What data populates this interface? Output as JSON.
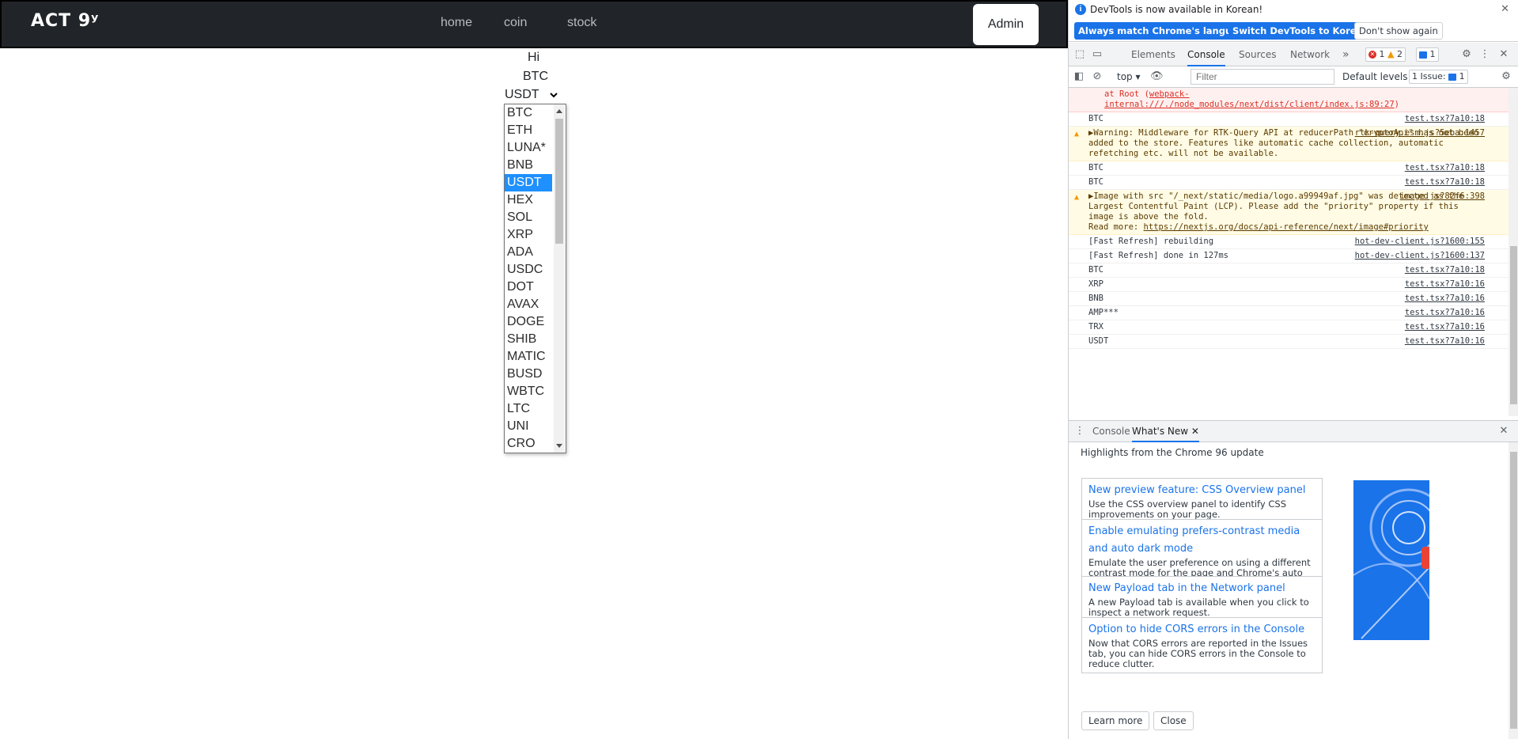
{
  "nav": {
    "logo": "ACT 9ʸ",
    "links": [
      "home",
      "coin",
      "stock"
    ],
    "admin": "Admin"
  },
  "main": {
    "greeting": "Hi",
    "selected_text": "BTC",
    "select_value": "USDT",
    "options": [
      "BTC",
      "ETH",
      "LUNA*",
      "BNB",
      "USDT",
      "HEX",
      "SOL",
      "XRP",
      "ADA",
      "USDC",
      "DOT",
      "AVAX",
      "DOGE",
      "SHIB",
      "MATIC",
      "BUSD",
      "WBTC",
      "LTC",
      "UNI",
      "CRO"
    ],
    "selected_option": "USDT"
  },
  "devtools": {
    "infobar": {
      "message": "DevTools is now available in Korean!",
      "btn_match": "Always match Chrome's language",
      "btn_switch": "Switch DevTools to Korean",
      "btn_dismiss": "Don't show again"
    },
    "tabs": [
      "Elements",
      "Console",
      "Sources",
      "Network"
    ],
    "active_tab": "Console",
    "more_tabs": "»",
    "badges": {
      "errors": "1",
      "warnings": "2",
      "messages": "1"
    },
    "filter": {
      "context": "top",
      "placeholder": "Filter",
      "levels": "Default levels",
      "issues": "1 Issue:",
      "issues_count": "1"
    },
    "console": [
      {
        "type": "error",
        "text": "at Root (",
        "link": "webpack-internal:///./node_modules/next/dist/client/index.js:89:27",
        "text_end": ")"
      },
      {
        "type": "log",
        "text": "BTC",
        "src": "test.tsx?7a10:18"
      },
      {
        "type": "warning",
        "text": "▶Warning: Middleware for RTK-Query API at reducerPath \"cryptoApi\" has not been added to the store. Features like automatic cache collection, automatic refetching etc. will not be available.",
        "src": "rtk-query.esm.js?5eba:1457"
      },
      {
        "type": "log",
        "text": "BTC",
        "src": "test.tsx?7a10:18"
      },
      {
        "type": "log",
        "text": "BTC",
        "src": "test.tsx?7a10:18"
      },
      {
        "type": "warning",
        "text": "▶Image with src \"/_next/static/media/logo.a99949af.jpg\" was detected as the Largest Contentful Paint (LCP). Please add the \"priority\" property if this image is above the fold.",
        "read_more": "Read more: ",
        "link": "https://nextjs.org/docs/api-reference/next/image#priority",
        "src": "image.js?82f6:398"
      },
      {
        "type": "log",
        "text": "[Fast Refresh] rebuilding",
        "src": "hot-dev-client.js?1600:155"
      },
      {
        "type": "log",
        "text": "[Fast Refresh] done in 127ms",
        "src": "hot-dev-client.js?1600:137"
      },
      {
        "type": "log",
        "text": "BTC",
        "src": "test.tsx?7a10:18"
      },
      {
        "type": "log",
        "text": "XRP",
        "src": "test.tsx?7a10:16"
      },
      {
        "type": "log",
        "text": "BNB",
        "src": "test.tsx?7a10:16"
      },
      {
        "type": "log",
        "text": "AMP***",
        "src": "test.tsx?7a10:16"
      },
      {
        "type": "log",
        "text": "TRX",
        "src": "test.tsx?7a10:16"
      },
      {
        "type": "log",
        "text": "USDT",
        "src": "test.tsx?7a10:16"
      }
    ],
    "prompt": "›",
    "drawer": {
      "tabs": [
        "Console",
        "What's New"
      ],
      "active_tab": "What's New"
    },
    "whats_new": {
      "heading": "Highlights from the Chrome 96 update",
      "cards": [
        {
          "title": "New preview feature: CSS Overview panel",
          "desc": "Use the CSS overview panel to identify CSS improvements on your page."
        },
        {
          "title": "Enable emulating prefers-contrast media and auto dark mode",
          "desc": "Emulate the user preference on using a different contrast mode for the page and Chrome's auto dark mode."
        },
        {
          "title": "New Payload tab in the Network panel",
          "desc": "A new Payload tab is available when you click to inspect a network request."
        },
        {
          "title": "Option to hide CORS errors in the Console",
          "desc": "Now that CORS errors are reported in the Issues tab, you can hide CORS errors in the Console to reduce clutter."
        }
      ],
      "learn_more": "Learn more",
      "close": "Close"
    }
  }
}
